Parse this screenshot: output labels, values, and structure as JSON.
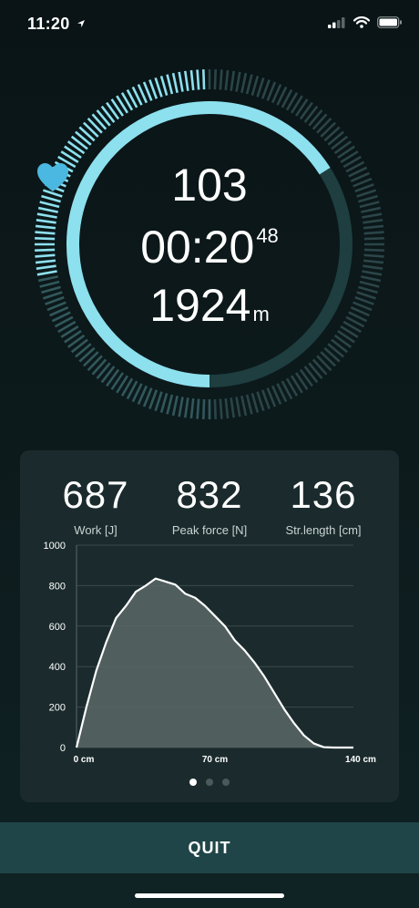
{
  "status_bar": {
    "time": "11:20",
    "icons": [
      "location-arrow-icon",
      "signal-icon",
      "wifi-icon",
      "battery-icon"
    ]
  },
  "workout": {
    "heart_rate": "103",
    "timer_main": "00:20",
    "timer_fraction": "48",
    "distance": "1924",
    "distance_unit": "m",
    "ring_progress": 0.5,
    "accent_color": "#8de0ee",
    "heart_color": "#4ab8e0"
  },
  "stroke_stats": [
    {
      "value": "687",
      "label": "Work [J]"
    },
    {
      "value": "832",
      "label": "Peak force [N]"
    },
    {
      "value": "136",
      "label": "Str.length [cm]"
    }
  ],
  "chart_data": {
    "type": "area",
    "title": "",
    "xlabel": "",
    "ylabel": "",
    "x": [
      0,
      5,
      10,
      15,
      20,
      25,
      30,
      35,
      40,
      45,
      50,
      55,
      60,
      65,
      70,
      75,
      80,
      85,
      90,
      95,
      100,
      105,
      110,
      115,
      120,
      125,
      130,
      135,
      140
    ],
    "y": [
      0,
      200,
      380,
      520,
      640,
      700,
      770,
      800,
      835,
      820,
      805,
      760,
      740,
      700,
      650,
      600,
      530,
      480,
      420,
      350,
      270,
      190,
      120,
      60,
      20,
      2,
      0,
      0,
      0
    ],
    "xlim": [
      0,
      140
    ],
    "ylim": [
      0,
      1000
    ],
    "x_ticks": [
      0,
      70,
      140
    ],
    "x_tick_labels": [
      "0 cm",
      "70 cm",
      "140 cm"
    ],
    "y_ticks": [
      0,
      200,
      400,
      600,
      800,
      1000
    ],
    "y_tick_labels": [
      "0",
      "200",
      "400",
      "600",
      "800",
      "1000"
    ],
    "grid": true
  },
  "pagination": {
    "count": 3,
    "active": 0
  },
  "quit_label": "QUIT"
}
